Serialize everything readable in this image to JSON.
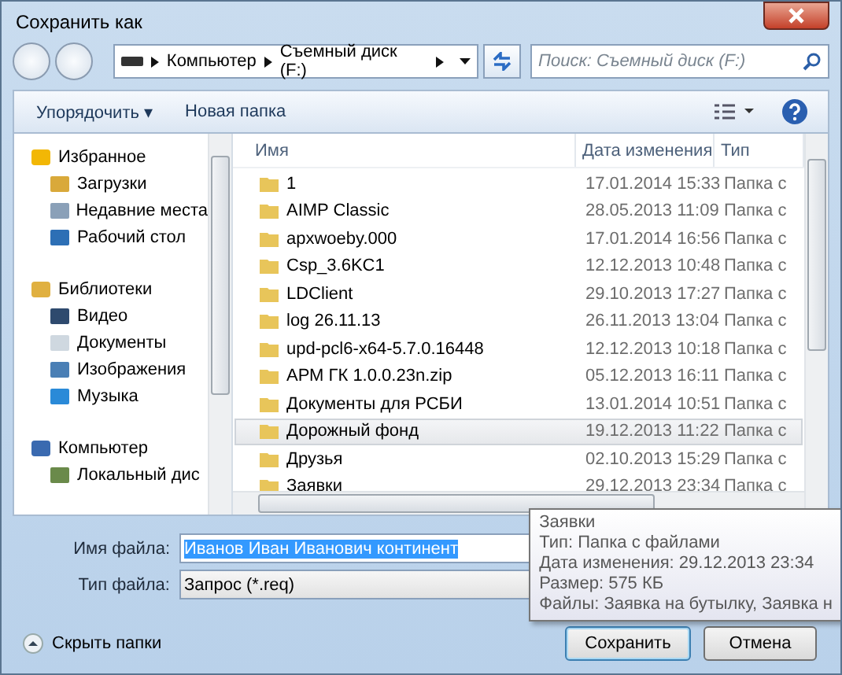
{
  "window": {
    "title": "Сохранить как"
  },
  "address": {
    "path": [
      "Компьютер",
      "Съемный диск (F:)"
    ]
  },
  "search": {
    "placeholder": "Поиск: Съемный диск (F:)"
  },
  "toolbar": {
    "organize": "Упорядочить ▾",
    "new_folder": "Новая папка"
  },
  "navigation": [
    {
      "label": "Избранное",
      "children": [
        {
          "label": "Загрузки"
        },
        {
          "label": "Недавние места"
        },
        {
          "label": "Рабочий стол"
        }
      ]
    },
    {
      "label": "Библиотеки",
      "children": [
        {
          "label": "Видео"
        },
        {
          "label": "Документы"
        },
        {
          "label": "Изображения"
        },
        {
          "label": "Музыка"
        }
      ]
    },
    {
      "label": "Компьютер",
      "children": [
        {
          "label": "Локальный дис"
        }
      ]
    }
  ],
  "table": {
    "columns": [
      "Имя",
      "Дата изменения",
      "Тип"
    ],
    "rows": [
      {
        "name": "1",
        "date": "17.01.2014 15:33",
        "type": "Папка с",
        "selected": false
      },
      {
        "name": "AIMP Classic",
        "date": "28.05.2013 11:09",
        "type": "Папка с",
        "selected": false
      },
      {
        "name": "apxwoeby.000",
        "date": "17.01.2014 16:56",
        "type": "Папка с",
        "selected": false
      },
      {
        "name": "Csp_3.6KC1",
        "date": "12.12.2013 10:48",
        "type": "Папка с",
        "selected": false
      },
      {
        "name": "LDClient",
        "date": "29.10.2013 17:27",
        "type": "Папка с",
        "selected": false
      },
      {
        "name": "log 26.11.13",
        "date": "26.11.2013 13:04",
        "type": "Папка с",
        "selected": false
      },
      {
        "name": "upd-pcl6-x64-5.7.0.16448",
        "date": "12.12.2013 10:18",
        "type": "Папка с",
        "selected": false
      },
      {
        "name": "АРМ ГК 1.0.0.23n.zip",
        "date": "05.12.2013 16:11",
        "type": "Папка с",
        "selected": false
      },
      {
        "name": "Документы для РСБИ",
        "date": "13.01.2014 10:51",
        "type": "Папка с",
        "selected": false
      },
      {
        "name": "Дорожный фонд",
        "date": "19.12.2013 11:22",
        "type": "Папка с",
        "selected": true
      },
      {
        "name": "Друзья",
        "date": "02.10.2013 15:29",
        "type": "Папка с",
        "selected": false
      },
      {
        "name": "Заявки",
        "date": "29.12.2013 23:34",
        "type": "Папка с",
        "selected": false
      }
    ]
  },
  "file_name": {
    "label": "Имя файла:",
    "value": "Иванов Иван Иванович континент",
    "text_selected": true
  },
  "file_type": {
    "label": "Тип файла:",
    "value": "Запрос (*.req)"
  },
  "hide_folders": "Скрыть папки",
  "buttons": [
    "Сохранить",
    "Отмена"
  ],
  "tooltip": [
    "Заявки",
    "Тип: Папка с файлами",
    "Дата изменения: 29.12.2013 23:34",
    "Размер: 575 КБ",
    "Файлы: Заявка на бутылку, Заявка н"
  ]
}
